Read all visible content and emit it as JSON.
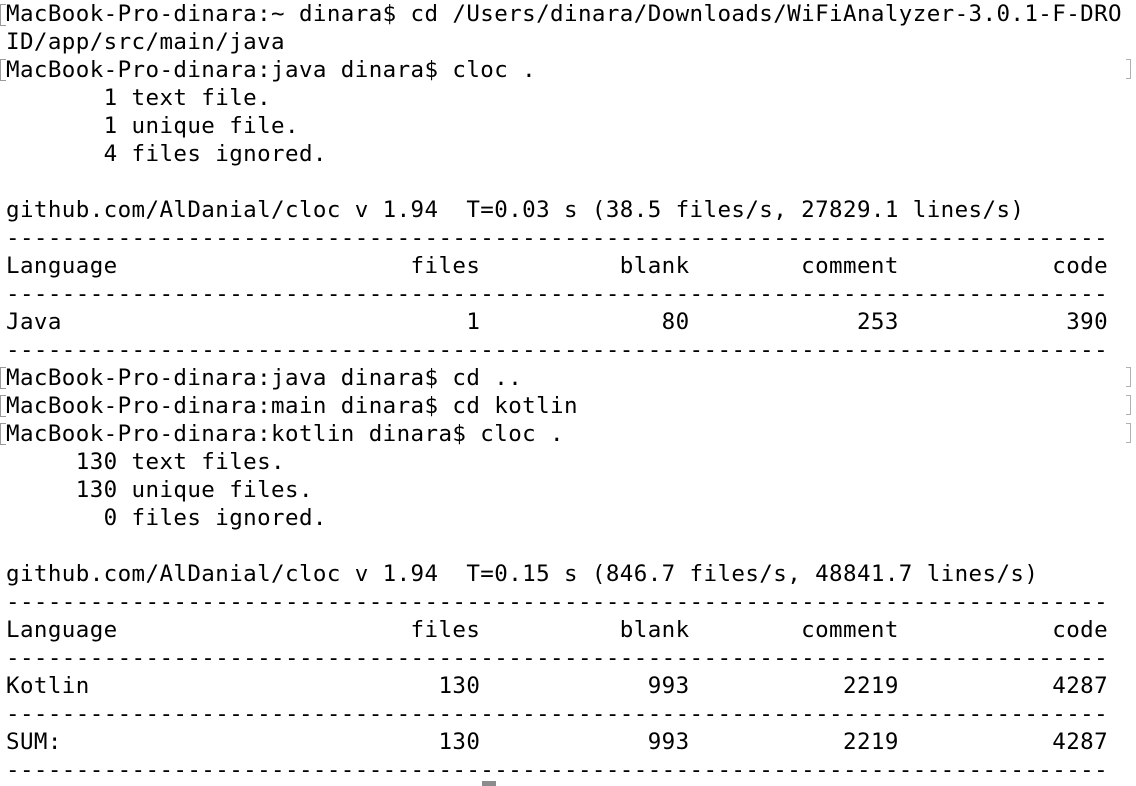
{
  "terminal": {
    "lines": [
      "MacBook-Pro-dinara:~ dinara$ cd /Users/dinara/Downloads/WiFiAnalyzer-3.0.1-F-DRO",
      "ID/app/src/main/java",
      "MacBook-Pro-dinara:java dinara$ cloc .",
      "       1 text file.",
      "       1 unique file.",
      "       4 files ignored.",
      "",
      "github.com/AlDanial/cloc v 1.94  T=0.03 s (38.5 files/s, 27829.1 lines/s)",
      "-------------------------------------------------------------------------------",
      "Language                     files          blank        comment           code",
      "-------------------------------------------------------------------------------",
      "Java                             1             80            253            390",
      "-------------------------------------------------------------------------------",
      "MacBook-Pro-dinara:java dinara$ cd ..",
      "MacBook-Pro-dinara:main dinara$ cd kotlin",
      "MacBook-Pro-dinara:kotlin dinara$ cloc .",
      "     130 text files.",
      "     130 unique files.",
      "       0 files ignored.",
      "",
      "github.com/AlDanial/cloc v 1.94  T=0.15 s (846.7 files/s, 48841.7 lines/s)",
      "-------------------------------------------------------------------------------",
      "Language                     files          blank        comment           code",
      "-------------------------------------------------------------------------------",
      "Kotlin                         130            993           2219           4287",
      "-------------------------------------------------------------------------------",
      "SUM:                           130            993           2219           4287",
      "-------------------------------------------------------------------------------"
    ]
  },
  "colors": {
    "background": "#ffffff",
    "text": "#000000",
    "cursor": "#8c8c8c"
  }
}
